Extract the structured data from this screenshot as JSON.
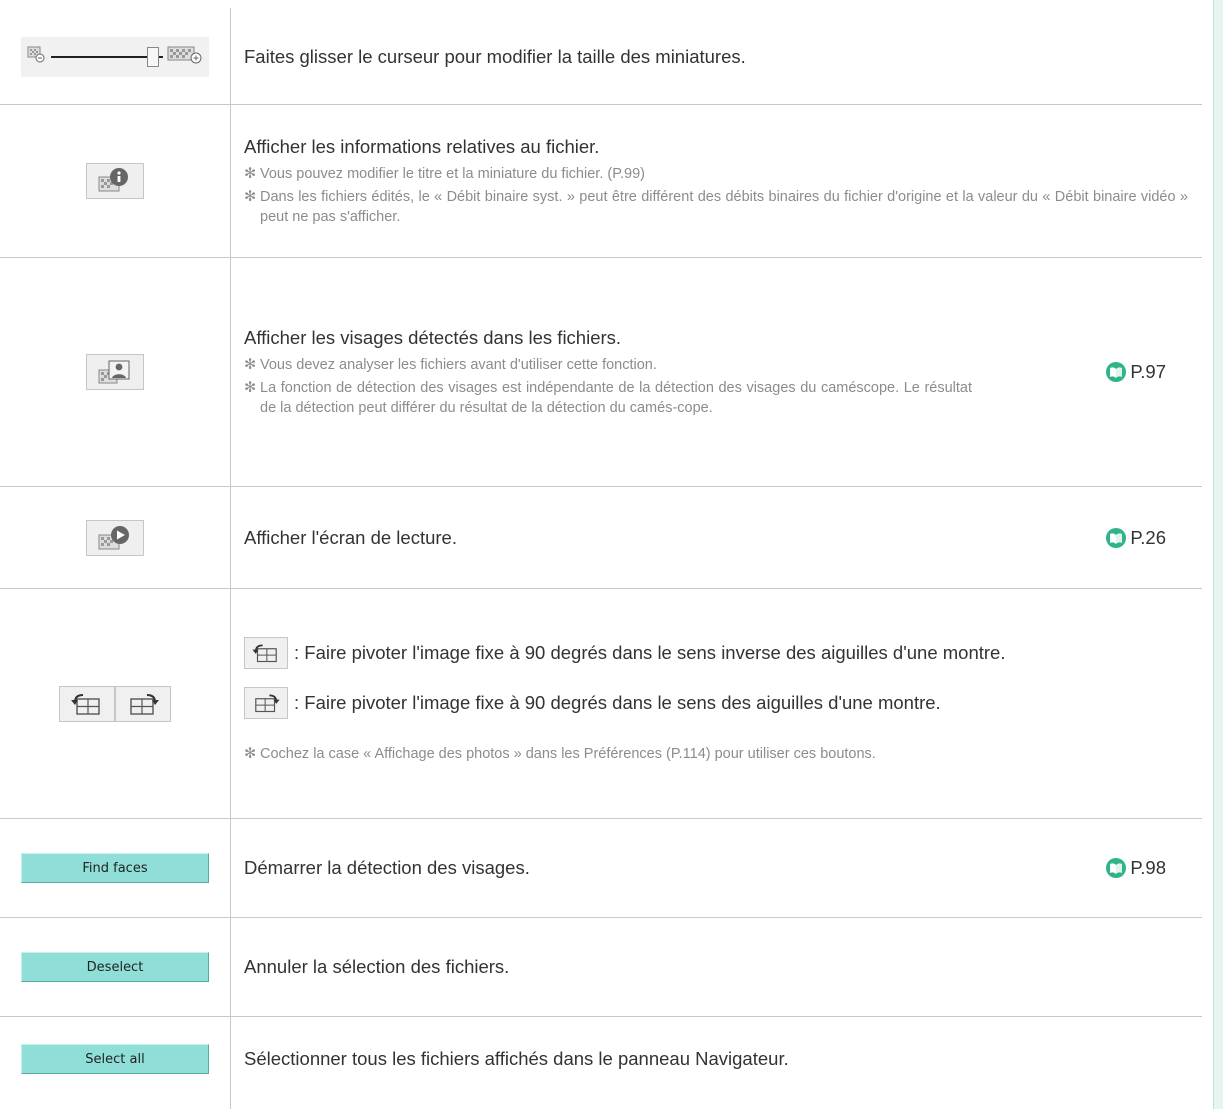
{
  "rows": {
    "slider": {
      "icon_name": "thumbnail-size-slider",
      "text": "Faites glisser le curseur pour modifier la taille des miniatures."
    },
    "info": {
      "icon_name": "file-info-icon",
      "text": "Afficher les informations relatives au fichier.",
      "notes": [
        "Vous pouvez modifier le titre et la miniature du fichier. (P.99)",
        "Dans les fichiers édités, le « Débit binaire syst. » peut être différent des débits binaires du fichier d'origine et la valeur du « Débit binaire vidéo » peut ne pas s'afficher."
      ]
    },
    "faces": {
      "icon_name": "face-display-icon",
      "text": "Afficher les visages détectés dans les fichiers.",
      "notes": [
        "Vous devez analyser les fichiers avant d'utiliser cette fonction.",
        "La fonction de détection des visages est indépendante de la détection des visages du caméscope. Le résultat de la détection peut différer du résultat de la détection du camés-cope."
      ],
      "ref": "P.97"
    },
    "play": {
      "icon_name": "playback-icon",
      "text": "Afficher l'écran de lecture.",
      "ref": "P.26"
    },
    "rotate": {
      "icon_names": [
        "rotate-left-icon",
        "rotate-right-icon"
      ],
      "left_text": ": Faire pivoter l'image fixe à 90 degrés dans le sens inverse des aiguilles d'une montre.",
      "right_text": ": Faire pivoter l'image fixe à 90 degrés dans le sens des aiguilles d'une montre.",
      "note": "Cochez la case « Affichage des photos » dans les Préférences (P.114) pour utiliser ces boutons."
    },
    "find_faces": {
      "button_label": "Find faces",
      "text": "Démarrer la détection des visages.",
      "ref": "P.98"
    },
    "deselect": {
      "button_label": "Deselect",
      "text": "Annuler la sélection des fichiers."
    },
    "select_all": {
      "button_label": "Select all",
      "text": "Sélectionner tous les fichiers affichés dans le panneau Navigateur."
    }
  },
  "note_symbol": "✻",
  "colors": {
    "accent": "#2eb38a",
    "button_bg": "#8fded8",
    "note_text": "#8c8c8c",
    "divider": "#c8c8c8"
  }
}
